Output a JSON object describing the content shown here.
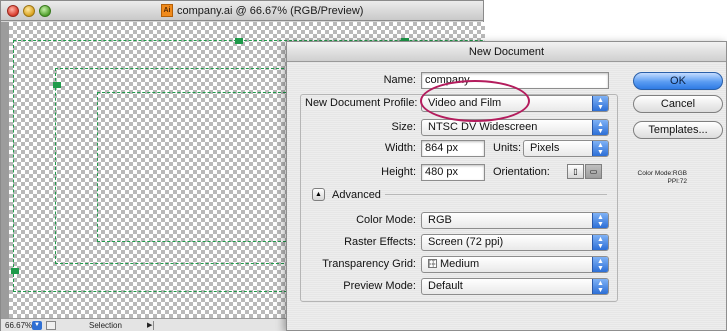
{
  "document_window": {
    "title": "company.ai @ 66.67% (RGB/Preview)",
    "app_icon": "Ai",
    "status_bar": {
      "zoom": "66.67%",
      "tool": "Selection"
    }
  },
  "dialog": {
    "title": "New Document",
    "name_label": "Name:",
    "name_value": "company",
    "profile_label": "New Document Profile:",
    "profile_value": "Video and Film",
    "size_label": "Size:",
    "size_value": "NTSC DV Widescreen",
    "width_label": "Width:",
    "width_value": "864 px",
    "units_label": "Units:",
    "units_value": "Pixels",
    "height_label": "Height:",
    "height_value": "480 px",
    "orientation_label": "Orientation:",
    "advanced_label": "Advanced",
    "color_mode_label": "Color Mode:",
    "color_mode_value": "RGB",
    "raster_label": "Raster Effects:",
    "raster_value": "Screen (72 ppi)",
    "transparency_label": "Transparency Grid:",
    "transparency_value": "Medium",
    "preview_label": "Preview Mode:",
    "preview_value": "Default",
    "ok_label": "OK",
    "cancel_label": "Cancel",
    "templates_label": "Templates...",
    "info_color_mode": "Color Mode:RGB",
    "info_ppi": "PPI:72"
  },
  "colors": {
    "accent": "#2f7be4",
    "guide": "#1f9a4a",
    "highlight": "#b41c5d"
  }
}
